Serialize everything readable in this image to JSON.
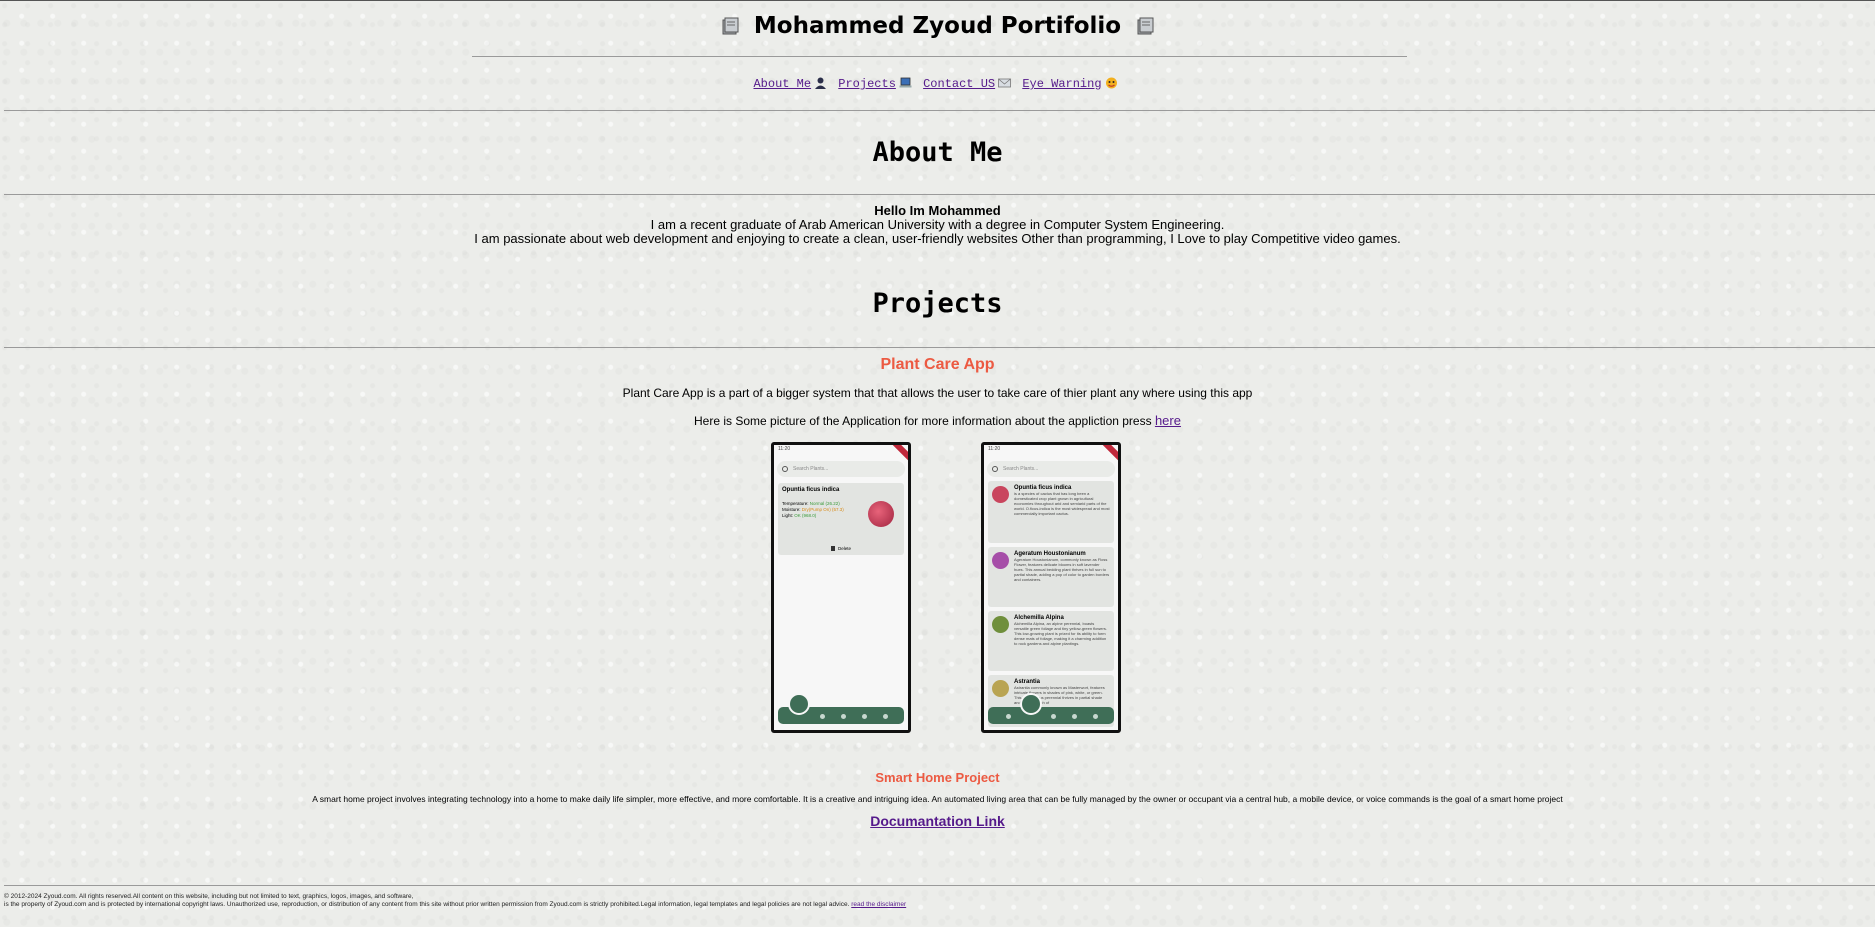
{
  "header": {
    "title": "Mohammed Zyoud Portifolio",
    "left_icon": "notebook-icon",
    "right_icon": "notebook-icon"
  },
  "nav": {
    "items": [
      {
        "label": "About Me",
        "icon": "person-icon"
      },
      {
        "label": "Projects",
        "icon": "laptop-icon"
      },
      {
        "label": "Contact US",
        "icon": "envelope-icon"
      },
      {
        "label": "Eye Warning",
        "icon": "face-icon"
      }
    ]
  },
  "about": {
    "heading": "About Me",
    "greeting": "Hello Im Mohammed",
    "line1": "I am a recent graduate of Arab American University with a degree in Computer System Engineering.",
    "line2": "I am passionate about web development and enjoying to create a clean, user-friendly websites Other than programming, I Love to play Competitive video games."
  },
  "projects": {
    "heading": "Projects",
    "plant": {
      "title": "Plant Care App",
      "desc": "Plant Care App is a part of a bigger system that that allows the user to take care of thier plant any where using this app",
      "pictures_text": "Here is Some picture of the Application for more information about the appliction press",
      "link": "here",
      "screen1": {
        "status": "11:20",
        "search": "Search Plants...",
        "card_title": "Opuntia ficus indica",
        "temperature_label": "Temperature",
        "temperature_value": "Normal (26.22)",
        "moisture_label": "Moisture",
        "moisture_value": "Dry(Pump On) (57.3)",
        "light_label": "Light",
        "light_value": "OK (968.0)",
        "delete": "Delete"
      },
      "screen2": {
        "status": "11:20",
        "search": "Search Plants...",
        "plants": [
          {
            "name": "Opuntia ficus indica",
            "text": "is a species of cactus that has long been a domesticated crop plant grown in agricultural economies throughout arid and semiarid parts of the world. O.ficus-indica is the most widespread and most commercially important cactus.",
            "color": "#c9465e"
          },
          {
            "name": "Ageratum Houstonianum",
            "text": "Ageratum Houstonianum, commonly known as Floss Flower, features delicate blooms in soft lavender hues. This annual bedding plant thrives in full sun to partial shade, adding a pop of color to garden borders and containers.",
            "color": "#a64ea8"
          },
          {
            "name": "Alchemilla Alpina",
            "text": "Alchemilla Alpina, an alpine perennial, boasts versatile green foliage and tiny yellow-green flowers. This low-growing plant is prized for its ability to form dense mats of foliage, making it a charming addition to rock gardens and alpine plantings.",
            "color": "#6f8f3c"
          },
          {
            "name": "Astrantia",
            "text": "Astrantia commonly known as Masterwort, features intricate flowers in shades of pink, white, or green. This herbaceous perennial thrives in partial shade and adds a touch of",
            "color": "#b9a452"
          }
        ]
      }
    },
    "smart": {
      "title": "Smart Home Project",
      "desc": "A smart home project involves integrating technology into a home to make daily life simpler, more effective, and more comfortable. It is a creative and intriguing idea. An automated living area that can be fully managed by the owner or occupant via a central hub, a mobile device, or voice commands is the goal of a smart home project",
      "link": "Documantation Link"
    }
  },
  "footer": {
    "line1": "© 2012-2024 Zyoud.com. All rights reserved.All content on this website, including but not limited to text, graphics, logos, images, and software,",
    "line2": "is the property of Zyoud.com and is protected by international copyright laws. Unauthorized use, reproduction, or distribution of any content from this site without prior written permission from Zyoud.com is strictly prohibited.Legal information, legal templates and legal policies are not legal advice.",
    "link": "read the disclaimer"
  },
  "colors": {
    "accent": "#ec5a42",
    "link": "#551a8b",
    "app_green": "#3f6e57"
  }
}
